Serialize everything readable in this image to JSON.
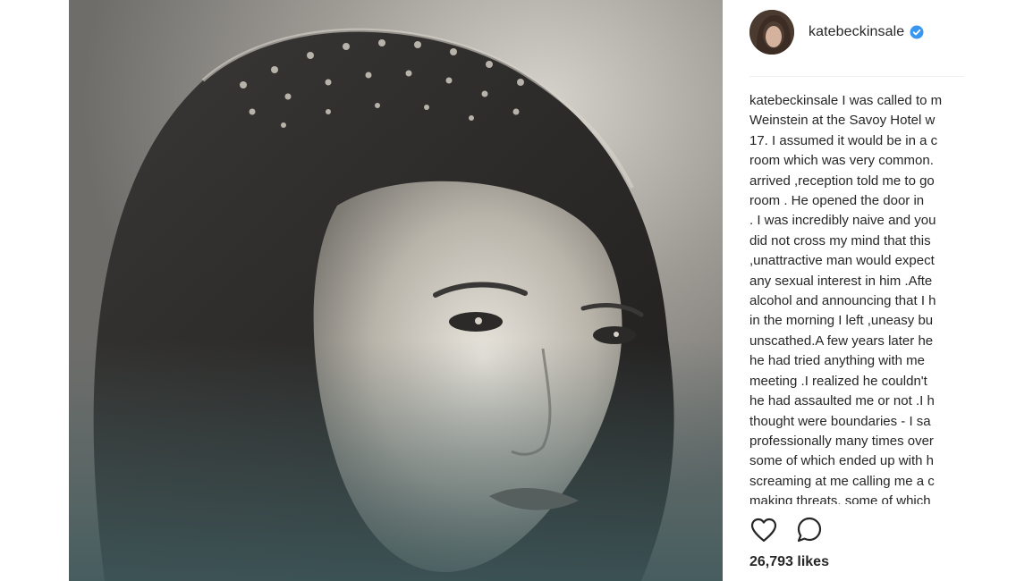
{
  "post": {
    "username": "katebeckinsale",
    "verified": true,
    "caption_lines": [
      "I was called to m",
      "Weinstein at the Savoy Hotel w",
      "17. I assumed it would be in a c",
      "room which was very common.",
      "arrived ,reception told me to go",
      "room . He opened the door in",
      ". I was incredibly naive and you",
      "did not cross my mind that this",
      ",unattractive man would expect",
      "any sexual interest in him .Afte",
      "alcohol and announcing that I h",
      "in the morning I left ,uneasy bu",
      "unscathed.A few years later he",
      "he had tried anything with me",
      "meeting .I realized he couldn't",
      "he had assaulted me or not .I h",
      "thought were boundaries - I sa",
      "professionally many times over",
      "some of which ended up with h",
      "screaming at me calling me a c",
      "making threats, some of which"
    ],
    "likes": "26,793 likes"
  },
  "icons": {
    "like": "heart-outline-icon",
    "comment": "comment-bubble-icon",
    "verified": "verified-badge-icon"
  },
  "colors": {
    "verified_blue": "#3897f0",
    "text": "#262626",
    "divider": "#efefef"
  }
}
